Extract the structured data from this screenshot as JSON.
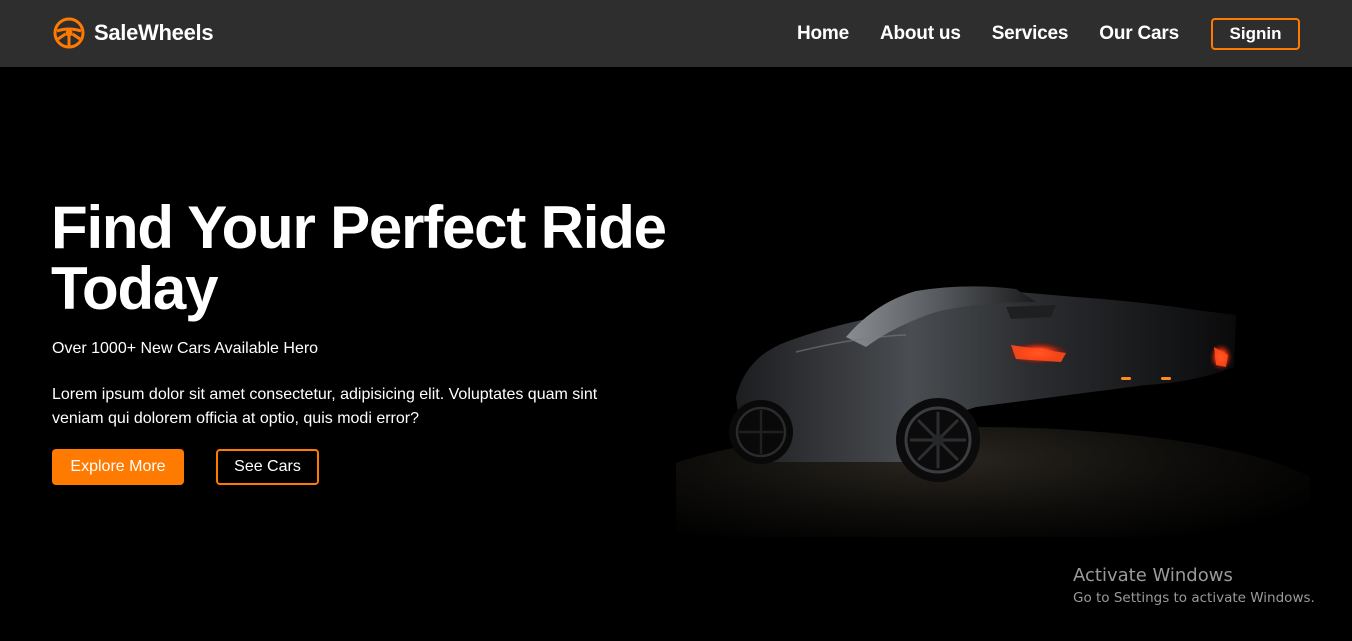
{
  "brand": {
    "name": "SaleWheels",
    "icon": "steering-wheel-icon",
    "accent_color": "#ff7a00"
  },
  "nav": {
    "items": [
      {
        "label": "Home"
      },
      {
        "label": "About us"
      },
      {
        "label": "Services"
      },
      {
        "label": "Our Cars"
      }
    ],
    "signin_label": "Signin"
  },
  "hero": {
    "title": "Find Your Perfect Ride Today",
    "subtitle": "Over 1000+ New Cars Available Hero",
    "description": "Lorem ipsum dolor sit amet consectetur, adipisicing elit. Voluptates quam sint veniam qui dolorem officia at optio, quis modi error?",
    "primary_button": "Explore More",
    "secondary_button": "See Cars",
    "image": "dark-sports-car-image"
  },
  "os_overlay": {
    "title": "Activate Windows",
    "subtitle": "Go to Settings to activate Windows."
  },
  "colors": {
    "navbar_bg": "#2e2e2e",
    "page_bg": "#000000",
    "accent": "#ff7a00"
  }
}
